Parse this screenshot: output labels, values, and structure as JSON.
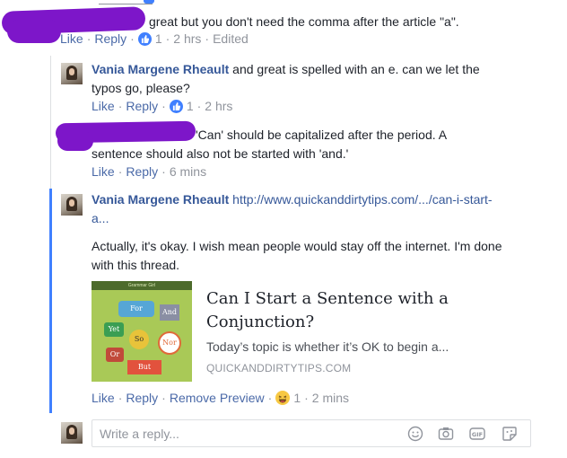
{
  "comment_top": {
    "text": "great but you don't need the comma after the article \"a\".",
    "like": "Like",
    "reply": "Reply",
    "like_count": "1",
    "time": "2 hrs",
    "edited": "Edited"
  },
  "reply1": {
    "author": "Vania Margene Rheault",
    "text": " and great is spelled with an e. can we let the typos go, please?",
    "like": "Like",
    "reply": "Reply",
    "like_count": "1",
    "time": "2 hrs"
  },
  "reply2": {
    "text": "'Can' should be capitalized after the period. A sentence should also not be started with 'and.'",
    "like": "Like",
    "reply": "Reply",
    "time": "6 mins"
  },
  "reply3": {
    "author": "Vania Margene Rheault",
    "link": "http://www.quickanddirtytips.com/.../can-i-start-a...",
    "body": "Actually, it's okay. I wish mean people would stay off the internet. I'm done with this thread.",
    "like": "Like",
    "reply": "Reply",
    "remove_preview": "Remove Preview",
    "reaction_count": "1",
    "time": "2 mins"
  },
  "preview": {
    "title": "Can I Start a Sentence with a Conjunction?",
    "description": "Today’s topic is whether it’s OK to begin a...",
    "domain": "QUICKANDDIRTYTIPS.COM",
    "image_words": [
      "For",
      "And",
      "Yet",
      "So",
      "Nor",
      "Or",
      "But"
    ],
    "image_banner": "Grammar Girl"
  },
  "composer": {
    "placeholder": "Write a reply..."
  },
  "colors": {
    "link": "#365899",
    "scribble": "#7d16c9",
    "thread_accent": "#4080ff"
  }
}
